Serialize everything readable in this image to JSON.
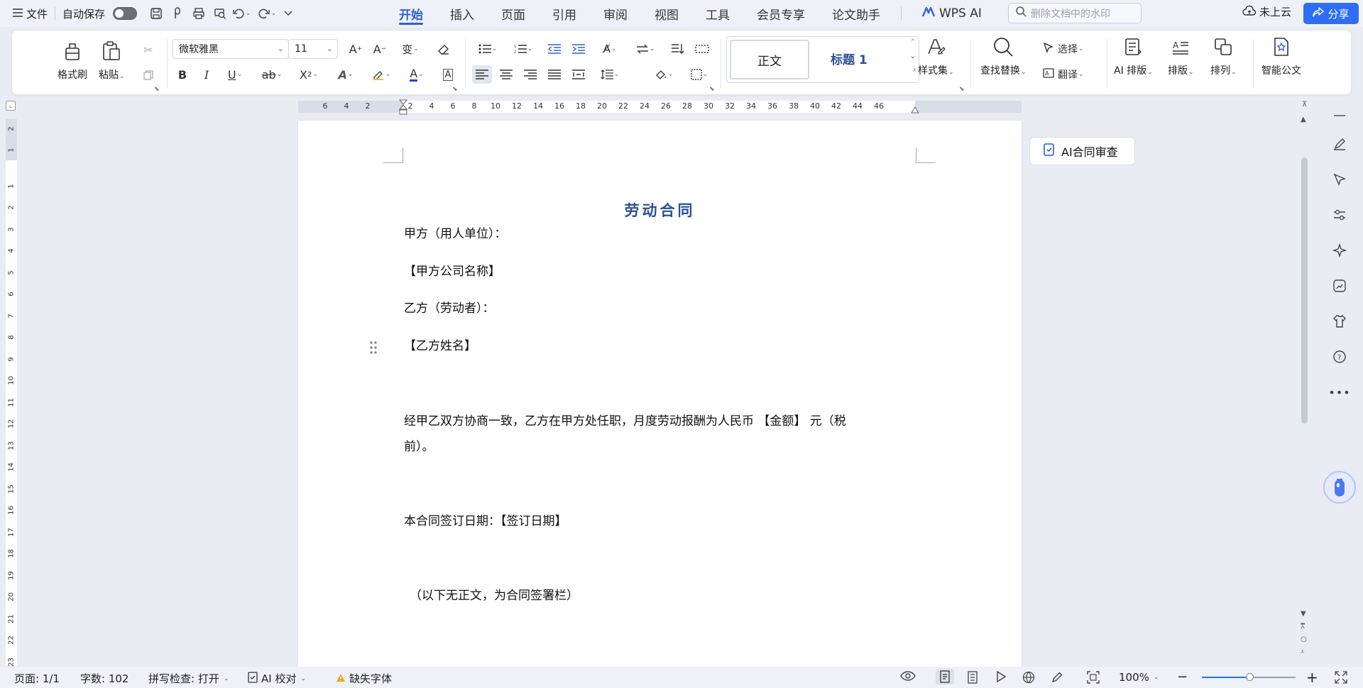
{
  "menubar": {
    "file_label": "文件",
    "autosave_label": "自动保存",
    "tabs": [
      "开始",
      "插入",
      "页面",
      "引用",
      "审阅",
      "视图",
      "工具",
      "会员专享",
      "论文助手"
    ],
    "wps_ai_label": "WPS AI",
    "search_placeholder": "删除文档中的水印",
    "cloud_label": "未上云",
    "share_label": "分享"
  },
  "ribbon": {
    "format_painter": "格式刷",
    "paste": "粘贴",
    "font_name": "微软雅黑",
    "font_size": "11",
    "style_normal": "正文",
    "style_heading1": "标题 1",
    "style_set": "样式集",
    "find_replace": "查找替换",
    "select": "选择",
    "translate": "翻译",
    "ai_layout": "AI 排版",
    "layout": "排版",
    "arrange": "排列",
    "smart_doc": "智能公文"
  },
  "ruler": {
    "h_ticks": [
      "6",
      "4",
      "2",
      "2",
      "4",
      "6",
      "8",
      "10",
      "12",
      "14",
      "16",
      "18",
      "20",
      "22",
      "24",
      "26",
      "28",
      "30",
      "32",
      "34",
      "36",
      "38",
      "40",
      "42",
      "44",
      "46"
    ],
    "v_ticks": [
      "2",
      "1",
      "1",
      "2",
      "3",
      "4",
      "5",
      "6",
      "7",
      "8",
      "9",
      "10",
      "11",
      "12",
      "13",
      "14",
      "15",
      "16",
      "17",
      "18",
      "19",
      "20",
      "21",
      "22",
      "23"
    ]
  },
  "document": {
    "title": "劳动合同",
    "lines": [
      "甲方（用人单位）：",
      "【甲方公司名称】",
      "乙方（劳动者）：",
      "【乙方姓名】",
      "经甲乙双方协商一致，乙方在甲方处任职，月度劳动报酬为人民币 【金额】 元（税",
      "前）。",
      "本合同签订日期：【签订日期】",
      "（以下无正文，为合同签署栏）"
    ]
  },
  "side_panel": {
    "ai_contract_review": "AI合同审查"
  },
  "statusbar": {
    "page": "页面: 1/1",
    "word_count": "字数: 102",
    "spellcheck": "拼写检查: 打开",
    "ai_proof": "AI 校对",
    "missing_font": "缺失字体",
    "zoom": "100%"
  },
  "colors": {
    "accent": "#2b5fd9",
    "share_button": "#2d6ef5",
    "heading_blue": "#2a5095",
    "warning": "#e8a317"
  }
}
